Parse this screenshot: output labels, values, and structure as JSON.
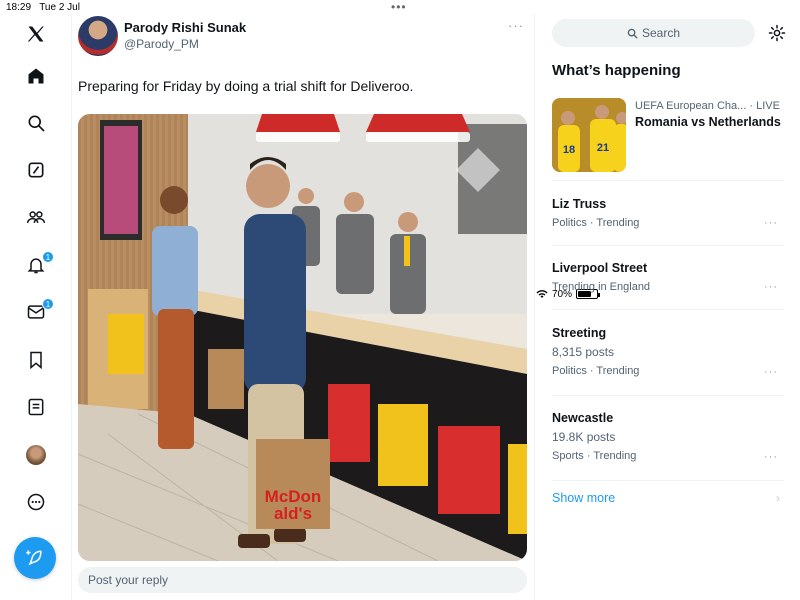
{
  "status": {
    "time": "18:29",
    "date": "Tue 2 Jul",
    "battery": "70%"
  },
  "nav": {
    "notifications_badge": "1",
    "messages_badge": "1"
  },
  "tweet": {
    "name": "Parody Rishi Sunak",
    "handle": "@Parody_PM",
    "text": "Preparing for Friday by doing a trial shift for Deliveroo.",
    "more": "···",
    "bag_text_1": "McDon",
    "bag_text_2": "ald's"
  },
  "reply": {
    "placeholder": "Post your reply"
  },
  "sidebar": {
    "search_placeholder": "Search",
    "whats_happening": "What’s happening",
    "featured": {
      "category": "UEFA European Cha...",
      "status": "· LIVE",
      "title": "Romania vs Netherlands"
    },
    "trends": [
      {
        "name": "Liz Truss",
        "posts": "",
        "meta": "Politics · Trending"
      },
      {
        "name": "Liverpool Street",
        "posts": "",
        "meta": "Trending in England"
      },
      {
        "name": "Streeting",
        "posts": "8,315 posts",
        "meta": "Politics · Trending"
      },
      {
        "name": "Newcastle",
        "posts": "19.8K posts",
        "meta": "Sports · Trending"
      }
    ],
    "show_more": "Show more",
    "more": "···",
    "chevron": "›"
  },
  "colors": {
    "accent": "#1d9bf0",
    "text": "#0f1419",
    "muted": "#536471"
  }
}
